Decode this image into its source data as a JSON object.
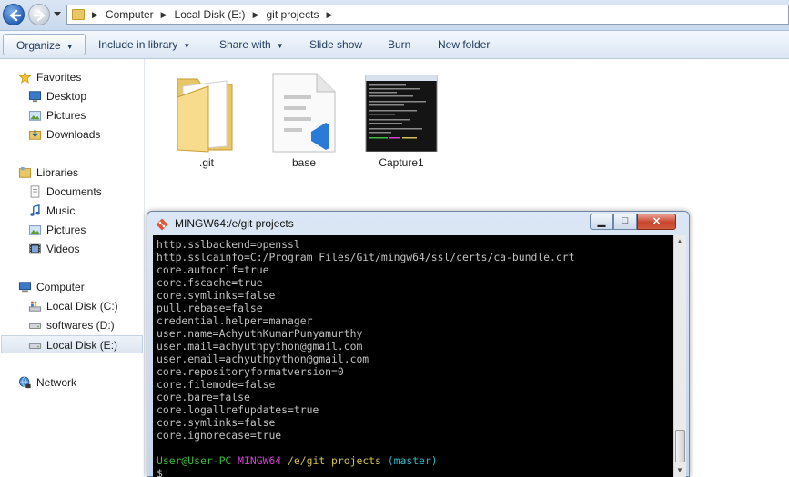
{
  "address": {
    "crumbs": [
      "Computer",
      "Local Disk (E:)",
      "git projects"
    ]
  },
  "toolbar": {
    "organize": "Organize",
    "include_in_library": "Include in library",
    "share_with": "Share with",
    "slide_show": "Slide show",
    "burn": "Burn",
    "new_folder": "New folder"
  },
  "nav": {
    "favorites": "Favorites",
    "desktop": "Desktop",
    "pictures_fav": "Pictures",
    "downloads": "Downloads",
    "libraries": "Libraries",
    "documents": "Documents",
    "music": "Music",
    "pictures_lib": "Pictures",
    "videos": "Videos",
    "computer": "Computer",
    "disk_c": "Local Disk (C:)",
    "disk_d": "softwares (D:)",
    "disk_e": "Local Disk (E:)",
    "network": "Network"
  },
  "files": [
    {
      "name": ".git",
      "icon": "folder-icon"
    },
    {
      "name": "base",
      "icon": "vscode-file-icon"
    },
    {
      "name": "Capture1",
      "icon": "image-thumbnail"
    }
  ],
  "terminal": {
    "title": "MINGW64:/e/git projects",
    "lines": [
      "http.sslbackend=openssl",
      "http.sslcainfo=C:/Program Files/Git/mingw64/ssl/certs/ca-bundle.crt",
      "core.autocrlf=true",
      "core.fscache=true",
      "core.symlinks=false",
      "pull.rebase=false",
      "credential.helper=manager",
      "user.name=AchyuthKumarPunyamurthy",
      "user.mail=achyuthpython@gmail.com",
      "user.email=achyuthpython@gmail.com",
      "core.repositoryformatversion=0",
      "core.filemode=false",
      "core.bare=false",
      "core.logallrefupdates=true",
      "core.symlinks=false",
      "core.ignorecase=true"
    ],
    "prompt": {
      "user": "User@User-PC",
      "system": "MINGW64",
      "path": "/e/git projects",
      "branch": "(master)",
      "symbol": "$"
    }
  },
  "colors": {
    "prompt_user": "#3fb93f",
    "prompt_system": "#d040d0",
    "prompt_path": "#d2c24a",
    "prompt_branch": "#30b8c8",
    "console_text": "#c0c0c0"
  }
}
